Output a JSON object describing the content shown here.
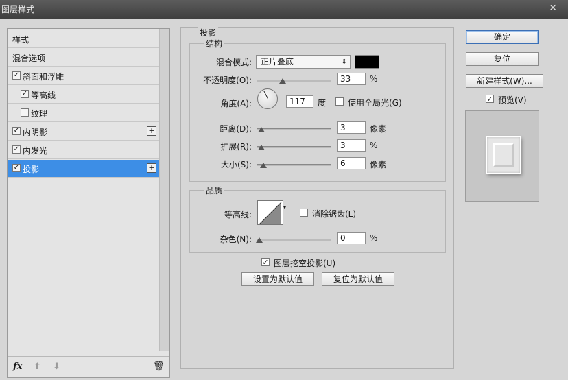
{
  "window": {
    "title": "图层样式",
    "close": "✕"
  },
  "styles_list": {
    "header": "样式",
    "items": [
      {
        "label": "混合选项",
        "checkbox": false
      },
      {
        "label": "斜面和浮雕",
        "checkbox": true,
        "checked": true
      },
      {
        "label": "等高线",
        "checkbox": true,
        "checked": true,
        "sub": true
      },
      {
        "label": "纹理",
        "checkbox": true,
        "checked": false,
        "sub": true
      },
      {
        "label": "内阴影",
        "checkbox": true,
        "checked": true,
        "plus": "+"
      },
      {
        "label": "内发光",
        "checkbox": true,
        "checked": true
      },
      {
        "label": "投影",
        "checkbox": true,
        "checked": true,
        "plus": "+",
        "selected": true
      }
    ],
    "footer": {
      "fx": "fx",
      "up": "⬆",
      "down": "⬇",
      "trash": "🗑"
    }
  },
  "panel": {
    "title": "投影",
    "structure": {
      "title": "结构",
      "blend_mode_label": "混合模式:",
      "blend_mode_value": "正片叠底",
      "blend_color": "#000000",
      "opacity_label": "不透明度(O):",
      "opacity_value": "33",
      "opacity_unit": "%",
      "angle_label": "角度(A):",
      "angle_value": "117",
      "angle_unit": "度",
      "global_light_label": "使用全局光(G)",
      "global_light_checked": false,
      "distance_label": "距离(D):",
      "distance_value": "3",
      "distance_unit": "像素",
      "spread_label": "扩展(R):",
      "spread_value": "3",
      "spread_unit": "%",
      "size_label": "大小(S):",
      "size_value": "6",
      "size_unit": "像素"
    },
    "quality": {
      "title": "品质",
      "contour_label": "等高线:",
      "antialias_label": "消除锯齿(L)",
      "antialias_checked": false,
      "noise_label": "杂色(N):",
      "noise_value": "0",
      "noise_unit": "%"
    },
    "knockout_label": "图层挖空投影(U)",
    "knockout_checked": true,
    "set_default_label": "设置为默认值",
    "reset_default_label": "复位为默认值"
  },
  "buttons": {
    "ok": "确定",
    "reset": "复位",
    "new_style": "新建样式(W)...",
    "preview_label": "预览(V)",
    "preview_checked": true
  }
}
